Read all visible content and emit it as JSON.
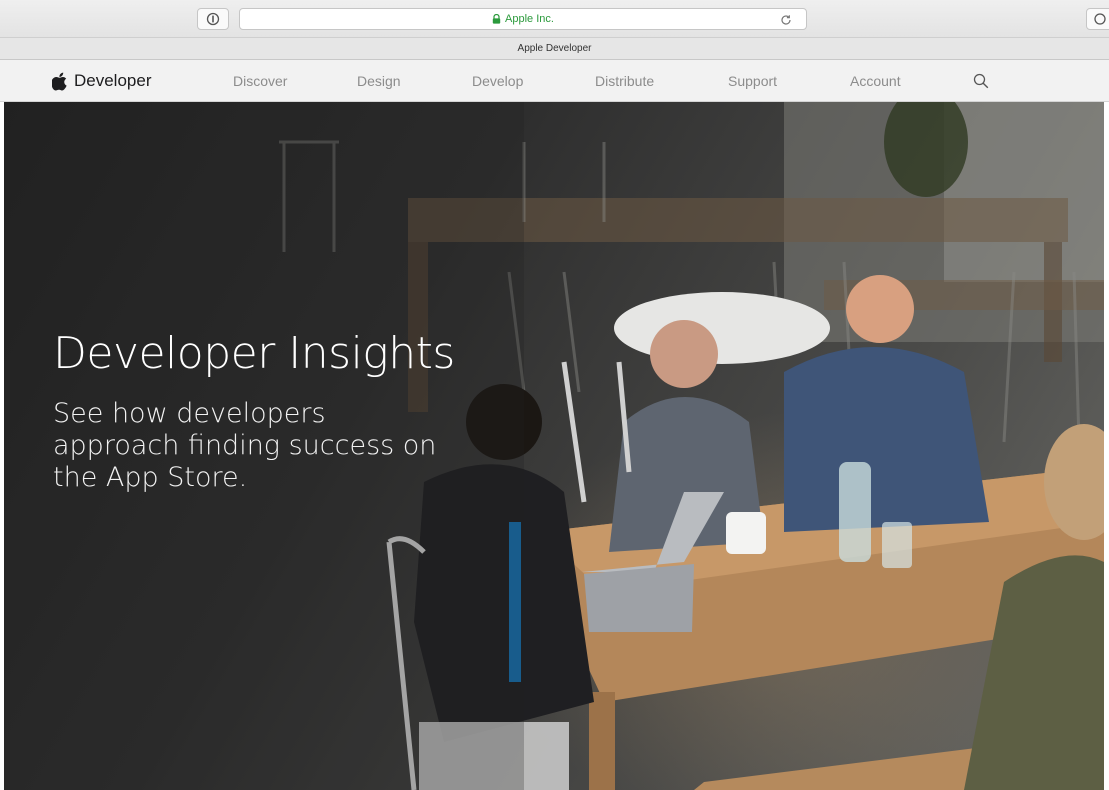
{
  "browser": {
    "address_text": "Apple Inc.",
    "tab_title": "Apple Developer",
    "icons": {
      "reader": "reader-icon",
      "lock": "lock-icon",
      "reload": "reload-icon",
      "share": "share-icon"
    },
    "accent_color": "#2b9a3c"
  },
  "site_nav": {
    "brand": "Developer",
    "items": [
      {
        "label": "Discover"
      },
      {
        "label": "Design"
      },
      {
        "label": "Develop"
      },
      {
        "label": "Distribute"
      },
      {
        "label": "Support"
      },
      {
        "label": "Account"
      }
    ],
    "icons": {
      "logo": "apple-logo-icon",
      "search": "search-icon"
    }
  },
  "hero": {
    "title": "Developer Insights",
    "subtitle": "See how developers approach finding success on the App Store."
  }
}
